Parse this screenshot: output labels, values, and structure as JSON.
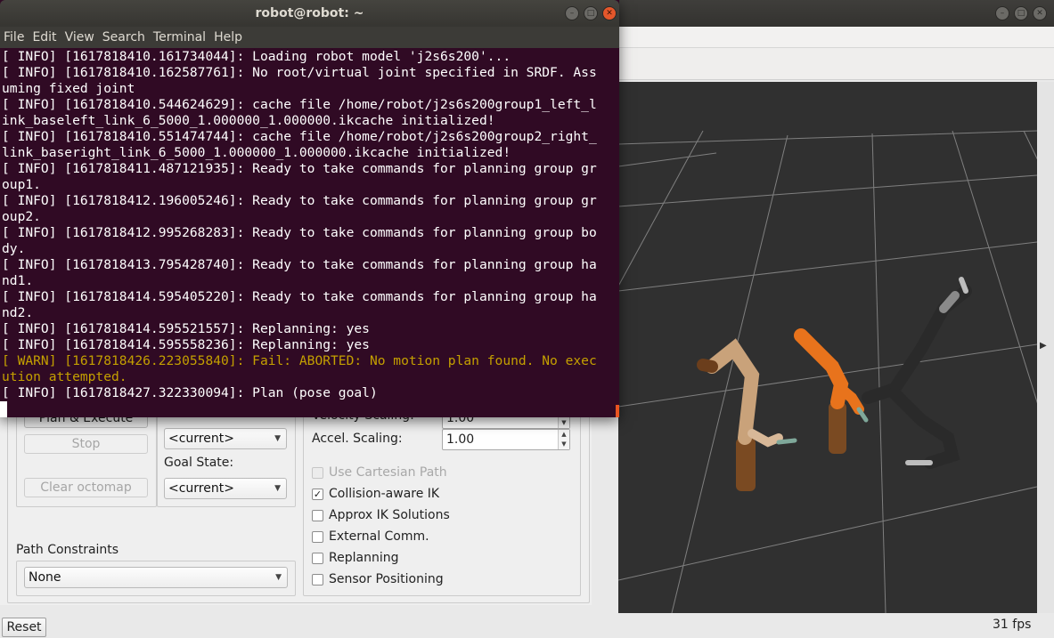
{
  "terminal": {
    "title": "robot@robot: ~",
    "menu": [
      "File",
      "Edit",
      "View",
      "Search",
      "Terminal",
      "Help"
    ],
    "lines": [
      {
        "text": "[ INFO] [1617818410.161734044]: Loading robot model 'j2s6s200'...",
        "level": "info"
      },
      {
        "text": "[ INFO] [1617818410.162587761]: No root/virtual joint specified in SRDF. Ass",
        "level": "info"
      },
      {
        "text": "uming fixed joint",
        "level": "info"
      },
      {
        "text": "[ INFO] [1617818410.544624629]: cache file /home/robot/j2s6s200group1_left_l",
        "level": "info"
      },
      {
        "text": "ink_baseleft_link_6_5000_1.000000_1.000000.ikcache initialized!",
        "level": "info"
      },
      {
        "text": "[ INFO] [1617818410.551474744]: cache file /home/robot/j2s6s200group2_right_",
        "level": "info"
      },
      {
        "text": "link_baseright_link_6_5000_1.000000_1.000000.ikcache initialized!",
        "level": "info"
      },
      {
        "text": "[ INFO] [1617818411.487121935]: Ready to take commands for planning group gr",
        "level": "info"
      },
      {
        "text": "oup1.",
        "level": "info"
      },
      {
        "text": "[ INFO] [1617818412.196005246]: Ready to take commands for planning group gr",
        "level": "info"
      },
      {
        "text": "oup2.",
        "level": "info"
      },
      {
        "text": "[ INFO] [1617818412.995268283]: Ready to take commands for planning group bo",
        "level": "info"
      },
      {
        "text": "dy.",
        "level": "info"
      },
      {
        "text": "[ INFO] [1617818413.795428740]: Ready to take commands for planning group ha",
        "level": "info"
      },
      {
        "text": "nd1.",
        "level": "info"
      },
      {
        "text": "[ INFO] [1617818414.595405220]: Ready to take commands for planning group ha",
        "level": "info"
      },
      {
        "text": "nd2.",
        "level": "info"
      },
      {
        "text": "[ INFO] [1617818414.595521557]: Replanning: yes",
        "level": "info"
      },
      {
        "text": "[ INFO] [1617818414.595558236]: Replanning: yes",
        "level": "info"
      },
      {
        "text": "[ WARN] [1617818426.223055840]: Fail: ABORTED: No motion plan found. No exec",
        "level": "warn"
      },
      {
        "text": "ution attempted.",
        "level": "warn"
      },
      {
        "text": "[ INFO] [1617818427.322330094]: Plan (pose goal)",
        "level": "info"
      }
    ]
  },
  "planning": {
    "plan_execute_label": "Plan & Execute",
    "stop_label": "Stop",
    "clear_octomap_label": "Clear octomap",
    "start_state_value": "<current>",
    "goal_state_label": "Goal State:",
    "goal_state_value": "<current>",
    "velocity_label": "Velocity Scaling:",
    "velocity_value": "1.00",
    "accel_label": "Accel. Scaling:",
    "accel_value": "1.00",
    "path_constraints_label": "Path Constraints",
    "path_constraints_value": "None",
    "options": [
      {
        "label": "Use Cartesian Path",
        "checked": false,
        "disabled": true
      },
      {
        "label": "Collision-aware IK",
        "checked": true,
        "disabled": false
      },
      {
        "label": "Approx IK Solutions",
        "checked": false,
        "disabled": false
      },
      {
        "label": "External Comm.",
        "checked": false,
        "disabled": false
      },
      {
        "label": "Replanning",
        "checked": false,
        "disabled": false
      },
      {
        "label": "Sensor Positioning",
        "checked": false,
        "disabled": false
      }
    ]
  },
  "footer": {
    "reset_label": "Reset",
    "fps_text": "31 fps"
  },
  "colors": {
    "terminal_bg": "#300a24",
    "warn": "#c4a000",
    "robot_orange": "#e8731c",
    "robot_brown": "#7a4a22",
    "robot_grey": "#8a8a8a"
  }
}
